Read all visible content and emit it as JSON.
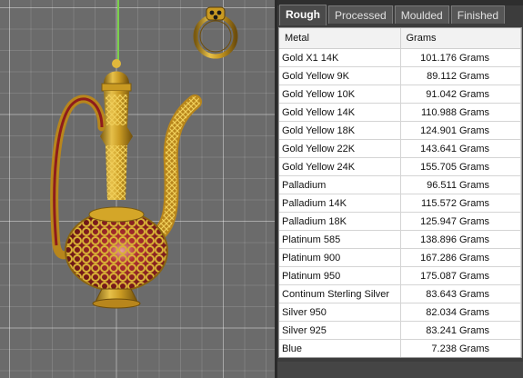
{
  "tabs": [
    {
      "label": "Rough",
      "active": true
    },
    {
      "label": "Processed",
      "active": false
    },
    {
      "label": "Moulded",
      "active": false
    },
    {
      "label": "Finished",
      "active": false
    }
  ],
  "table": {
    "columns": [
      "Metal",
      "Grams"
    ],
    "rows": [
      {
        "metal": "Gold X1 14K",
        "grams": "101.176 Grams"
      },
      {
        "metal": "Gold Yellow 9K",
        "grams": "89.112 Grams"
      },
      {
        "metal": "Gold Yellow 10K",
        "grams": "91.042 Grams"
      },
      {
        "metal": "Gold Yellow 14K",
        "grams": "110.988 Grams"
      },
      {
        "metal": "Gold Yellow 18K",
        "grams": "124.901 Grams"
      },
      {
        "metal": "Gold Yellow 22K",
        "grams": "143.641 Grams"
      },
      {
        "metal": "Gold Yellow 24K",
        "grams": "155.705 Grams"
      },
      {
        "metal": "Palladium",
        "grams": "96.511 Grams"
      },
      {
        "metal": "Palladium 14K",
        "grams": "115.572 Grams"
      },
      {
        "metal": "Palladium 18K",
        "grams": "125.947 Grams"
      },
      {
        "metal": "Platinum 585",
        "grams": "138.896 Grams"
      },
      {
        "metal": "Platinum 900",
        "grams": "167.286 Grams"
      },
      {
        "metal": "Platinum 950",
        "grams": "175.087 Grams"
      },
      {
        "metal": "Continum Sterling Silver",
        "grams": "83.643 Grams"
      },
      {
        "metal": "Silver 950",
        "grams": "82.034 Grams"
      },
      {
        "metal": "Silver 925",
        "grams": "83.241 Grams"
      },
      {
        "metal": "Blue",
        "grams": "7.238 Grams"
      }
    ]
  },
  "viewport": {
    "objects": [
      "ring-model",
      "ewer-model"
    ],
    "colors": {
      "gold": "#d4a628",
      "gold_dark": "#8a6410",
      "ruby": "#8e1c1c",
      "axis": "#7ad04a"
    }
  }
}
